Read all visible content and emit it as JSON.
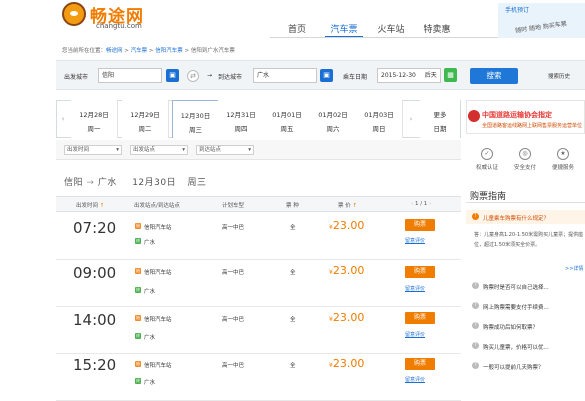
{
  "header": {
    "logo_text": "畅途网",
    "logo_domain": "changtu.com",
    "nav": [
      "首页",
      "汽车票",
      "火车站",
      "特卖惠"
    ],
    "promo_title": "手机预订",
    "promo_sub": "随时 随地 购买车票"
  },
  "breadcrumb": {
    "prefix": "您当前所在位置：",
    "items": [
      "畅途网",
      "汽车票",
      "信阳汽车票",
      "信阳到广水汽车票"
    ],
    "sep": ">"
  },
  "search": {
    "from_label": "出发城市",
    "from_value": "信阳",
    "to_label": "到达城市",
    "to_value": "广水",
    "date_label": "乘车日期",
    "date_value": "2015-12-30",
    "day_label": "后天",
    "search_button": "搜索",
    "history_label": "搜索历史"
  },
  "date_tabs": [
    {
      "date": "12月28日",
      "week": "周一"
    },
    {
      "date": "12月29日",
      "week": "周二"
    },
    {
      "date": "12月30日",
      "week": "周三"
    },
    {
      "date": "12月31日",
      "week": "周四"
    },
    {
      "date": "01月01日",
      "week": "周五"
    },
    {
      "date": "01月02日",
      "week": "周六"
    },
    {
      "date": "01月03日",
      "week": "周日"
    }
  ],
  "more_dates": {
    "line1": "更多",
    "line2": "日期"
  },
  "filters": [
    "出发时间",
    "出发站点",
    "到达站点"
  ],
  "route": {
    "from": "信阳",
    "arrow": "→",
    "to": "广水",
    "date": "12月30日",
    "week": "周三"
  },
  "table": {
    "headers": {
      "time": "出发时间",
      "up": "↑",
      "station": "出发站点/到达站点",
      "model": "计划车型",
      "type": "票 种",
      "price": "票 价",
      "price_up": "↑"
    },
    "pager": "1 / 1",
    "rows": [
      {
        "time": "07:20",
        "from": "信阳汽车站",
        "to": "广水",
        "model": "高一中巴",
        "type": "全",
        "price": "23.00",
        "buy": "购票",
        "remark": "留意评价"
      },
      {
        "time": "09:00",
        "from": "信阳汽车站",
        "to": "广水",
        "model": "高一中巴",
        "type": "全",
        "price": "23.00",
        "buy": "购票",
        "remark": "留意评价"
      },
      {
        "time": "14:00",
        "from": "信阳汽车站",
        "to": "广水",
        "model": "高一中巴",
        "type": "全",
        "price": "23.00",
        "buy": "购票",
        "remark": "留意评价"
      },
      {
        "time": "15:20",
        "from": "信阳汽车站",
        "to": "广水",
        "model": "高一中巴",
        "type": "全",
        "price": "23.00",
        "buy": "购票",
        "remark": "留意评价"
      }
    ],
    "currency": "¥",
    "from_tag": "始",
    "to_tag": "终"
  },
  "sidebar": {
    "banner_title": "中国道路运输协会指定",
    "banner_sub": "全国道路客运线路网上联网售票服务运营单位",
    "services": [
      "权威认证",
      "安全支付",
      "便捷服务"
    ],
    "guide_title": "购票指南",
    "faq_highlight": "儿童乘车购票有什么规定？",
    "faq_answer": "答：儿童身高1.20-1.50米需购买儿童票；提供座位，超过1.50米须买全价票。",
    "faq_more": ">>详情",
    "faqs": [
      "购票时是否可以自己选择...",
      "网上购票需要支付手续费...",
      "购票成功后如何取票？",
      "购买儿童票，价格可以优...",
      "一般可以提前几天购票？"
    ]
  },
  "colors": {
    "accent": "#1a6fd4",
    "orange": "#f07c00",
    "green": "#3eb94f"
  }
}
